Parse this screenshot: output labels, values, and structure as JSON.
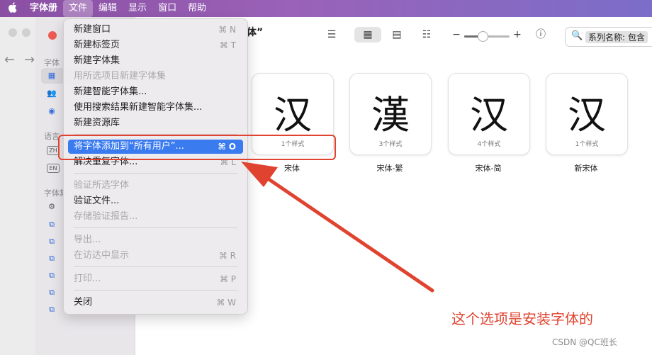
{
  "menubar": {
    "apple": "",
    "items": [
      "字体册",
      "文件",
      "编辑",
      "显示",
      "窗口",
      "帮助"
    ]
  },
  "toolbar": {
    "title": "体”",
    "search_value": "系列名称: 包含",
    "zoom_minus": "−",
    "zoom_plus": "+"
  },
  "sidebar": {
    "section_fonts": "字体",
    "section_language": "语言",
    "section_collections": "字体集",
    "badge_zh": "ZH",
    "badge_en": "EN"
  },
  "file_menu": {
    "items": [
      {
        "label": "新建窗口",
        "shortcut": "⌘ N",
        "disabled": false
      },
      {
        "label": "新建标签页",
        "shortcut": "⌘ T",
        "disabled": false
      },
      {
        "label": "新建字体集",
        "shortcut": "",
        "disabled": false
      },
      {
        "label": "用所选项目新建字体集",
        "shortcut": "",
        "disabled": true
      },
      {
        "label": "新建智能字体集...",
        "shortcut": "",
        "disabled": false
      },
      {
        "label": "使用搜索结果新建智能字体集...",
        "shortcut": "",
        "disabled": false
      },
      {
        "label": "新建资源库",
        "shortcut": "",
        "disabled": false
      },
      {
        "label": "将字体添加到“所有用户”...",
        "shortcut": "⌘ O",
        "disabled": false,
        "highlighted": true
      },
      {
        "label": "解决重复字体...",
        "shortcut": "⌘ L",
        "disabled": false
      },
      {
        "label": "验证所选字体",
        "shortcut": "",
        "disabled": true
      },
      {
        "label": "验证文件...",
        "shortcut": "",
        "disabled": false
      },
      {
        "label": "存储验证报告...",
        "shortcut": "",
        "disabled": true
      },
      {
        "label": "导出...",
        "shortcut": "",
        "disabled": true
      },
      {
        "label": "在访达中显示",
        "shortcut": "⌘ R",
        "disabled": true
      },
      {
        "label": "打印...",
        "shortcut": "⌘ P",
        "disabled": true
      },
      {
        "label": "关闭",
        "shortcut": "⌘ W",
        "disabled": false
      }
    ]
  },
  "fonts": [
    {
      "glyph": "汉",
      "styles": "1个样式",
      "name": "宋体"
    },
    {
      "glyph": "漢",
      "styles": "3个样式",
      "name": "宋体-繁"
    },
    {
      "glyph": "汉",
      "styles": "4个样式",
      "name": "宋体-简"
    },
    {
      "glyph": "汉",
      "styles": "1个样式",
      "name": "新宋体"
    }
  ],
  "annotation": {
    "text": "这个选项是安装字体的",
    "color": "#e0432f"
  },
  "watermark": "CSDN @QC班长",
  "colors": {
    "accent": "#3a7bf0",
    "annotation_red": "#e0432f"
  }
}
